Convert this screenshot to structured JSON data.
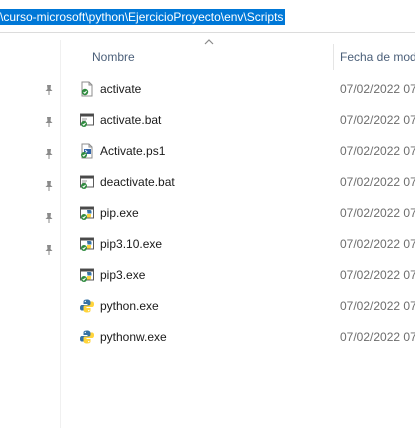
{
  "address": {
    "path": "\\curso-microsoft\\python\\EjercicioProyecto\\env\\Scripts"
  },
  "columns": {
    "name": "Nombre",
    "date": "Fecha de mod"
  },
  "files": [
    {
      "name": "activate",
      "date": "07/02/2022 07:",
      "icon": "script-file-icon"
    },
    {
      "name": "activate.bat",
      "date": "07/02/2022 07:",
      "icon": "batch-file-icon"
    },
    {
      "name": "Activate.ps1",
      "date": "07/02/2022 07:",
      "icon": "powershell-script-icon"
    },
    {
      "name": "deactivate.bat",
      "date": "07/02/2022 07:",
      "icon": "batch-file-icon"
    },
    {
      "name": "pip.exe",
      "date": "07/02/2022 07:",
      "icon": "python-exe-icon"
    },
    {
      "name": "pip3.10.exe",
      "date": "07/02/2022 07:",
      "icon": "python-exe-icon"
    },
    {
      "name": "pip3.exe",
      "date": "07/02/2022 07:",
      "icon": "python-exe-icon"
    },
    {
      "name": "python.exe",
      "date": "07/02/2022 07:",
      "icon": "python-logo-icon"
    },
    {
      "name": "pythonw.exe",
      "date": "07/02/2022 07:",
      "icon": "python-logo-icon"
    }
  ],
  "pins": [
    "pin-icon",
    "pin-icon",
    "pin-icon",
    "pin-icon",
    "pin-icon",
    "pin-icon"
  ]
}
